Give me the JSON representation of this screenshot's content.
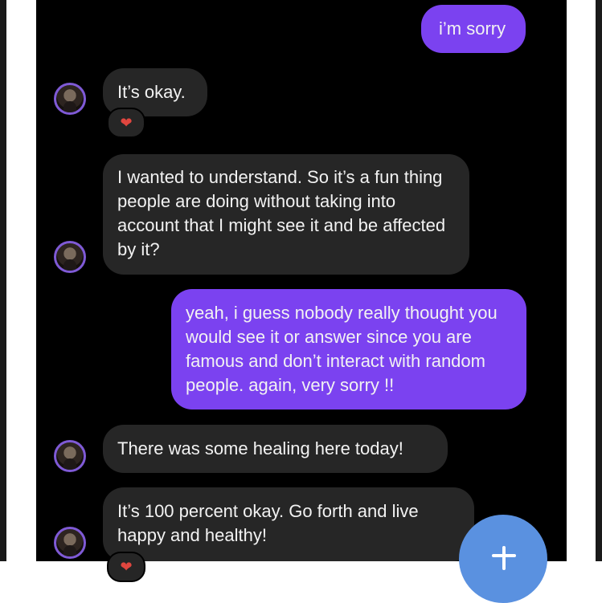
{
  "messages": [
    {
      "from": "me",
      "text": "i’m sorry"
    },
    {
      "from": "them",
      "text": "It’s okay.",
      "reaction": "❤"
    },
    {
      "from": "them",
      "text": "I wanted to understand. So it’s a fun thing people are doing without taking into account that I might see it and be affected by it?"
    },
    {
      "from": "me",
      "text": "yeah, i guess nobody really thought you would see it or answer since you are famous and don’t interact with random people. again, very sorry !!"
    },
    {
      "from": "them",
      "text": "There was some healing here today!"
    },
    {
      "from": "them",
      "text": "It’s 100 percent okay. Go forth and live happy and healthy!",
      "reaction": "❤"
    }
  ],
  "colors": {
    "sent_bubble": "#7b42f0",
    "received_bubble": "#262626",
    "background": "#000000",
    "fab": "#5a91e0",
    "reaction_heart": "#e0463f"
  },
  "icons": {
    "avatar": "profile-photo",
    "reaction": "heart-icon",
    "fab": "plus-icon"
  }
}
